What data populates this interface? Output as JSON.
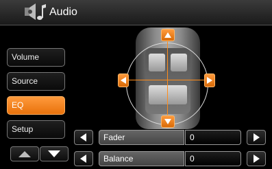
{
  "header": {
    "title": "Audio",
    "icon": "speaker-music-icon"
  },
  "sidebar": {
    "items": [
      {
        "label": "Volume",
        "active": false
      },
      {
        "label": "Source",
        "active": false
      },
      {
        "label": "EQ",
        "active": true
      },
      {
        "label": "Setup",
        "active": false
      }
    ],
    "page_up_icon": "triangle-up-icon",
    "page_down_icon": "triangle-down-icon"
  },
  "balance_pad": {
    "up_icon": "arrow-up-icon",
    "down_icon": "arrow-down-icon",
    "left_icon": "arrow-left-icon",
    "right_icon": "arrow-right-icon"
  },
  "controls": {
    "fader": {
      "label": "Fader",
      "value": "0"
    },
    "balance": {
      "label": "Balance",
      "value": "0"
    }
  },
  "colors": {
    "accent": "#f08020",
    "background": "#000000"
  }
}
